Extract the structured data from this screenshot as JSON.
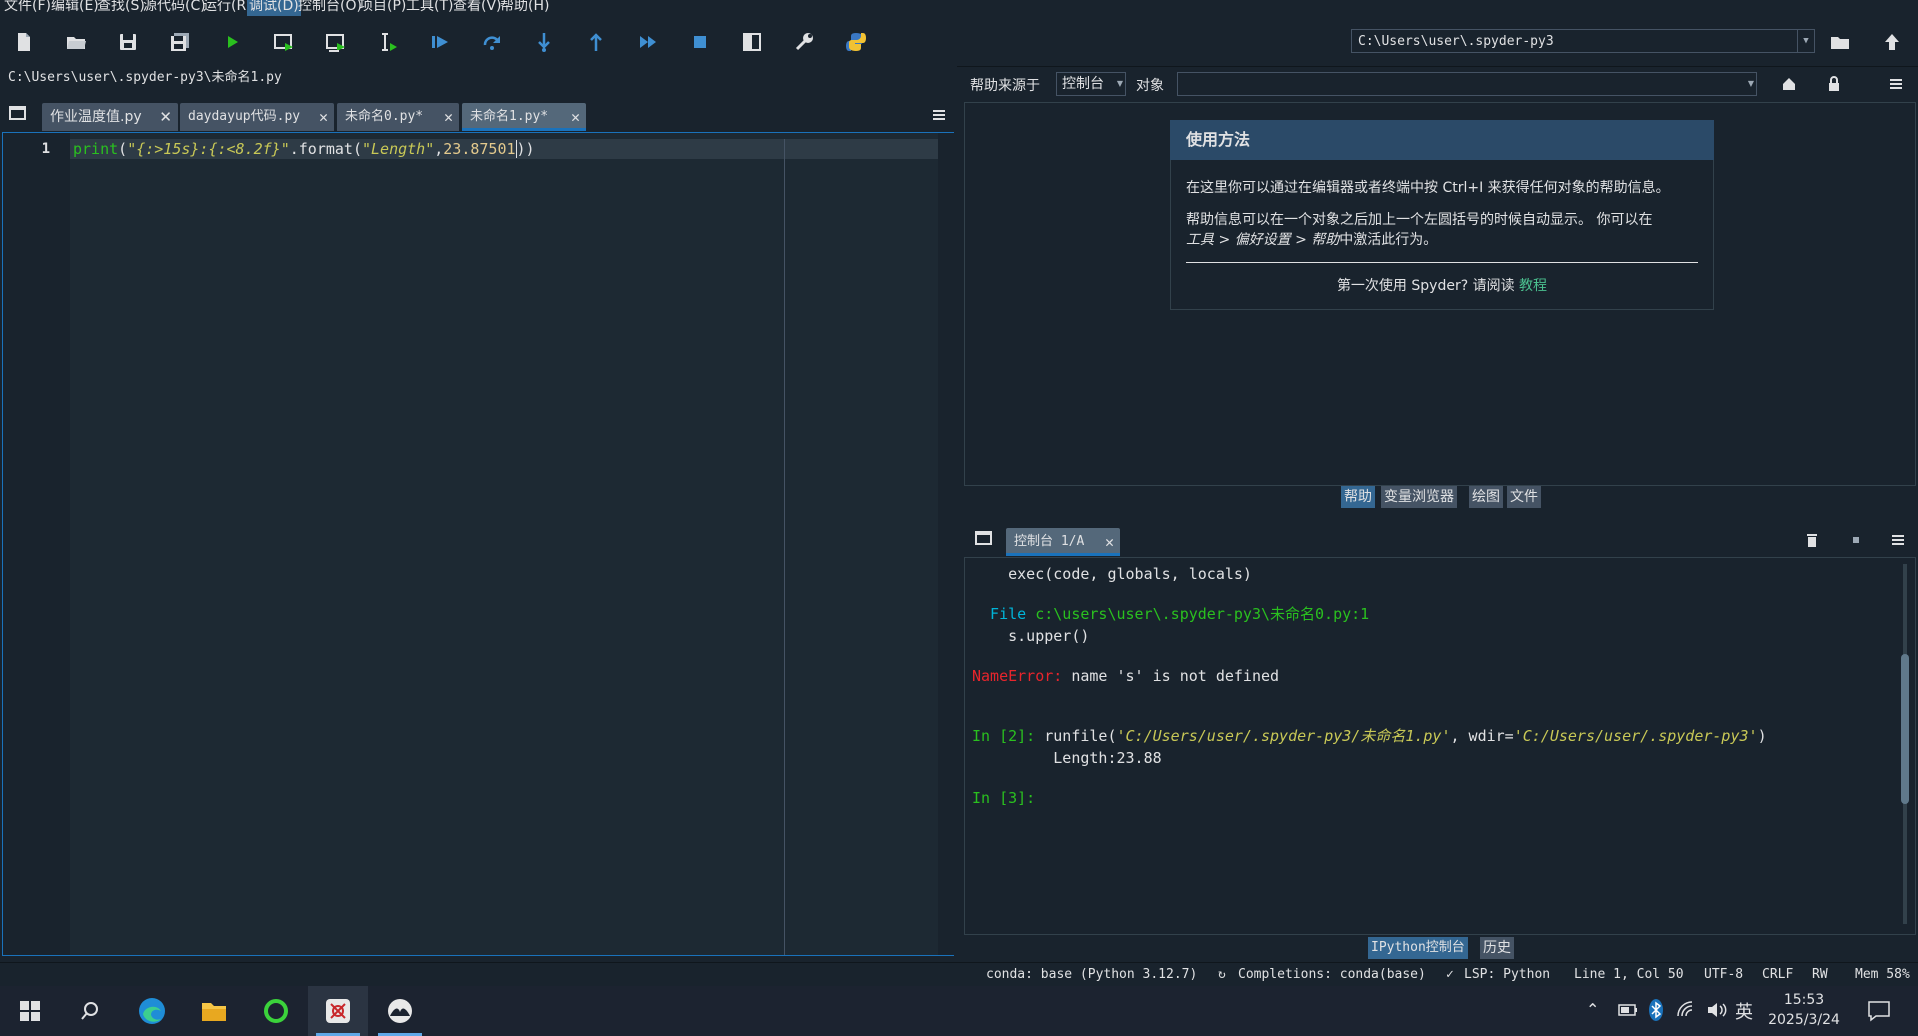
{
  "menubar": {
    "items": [
      "文件(F)",
      "编辑(E)",
      "查找(S)",
      "源代码(C)",
      "运行(R)",
      "调试(D)",
      "控制台(O)",
      "项目(P)",
      "工具(T)",
      "查看(V)",
      "帮助(H)"
    ],
    "active_index": 5
  },
  "toolbar": {
    "icons": [
      "new-file-icon",
      "open-file-icon",
      "save-icon",
      "save-all-icon",
      "run-icon",
      "run-cell-icon",
      "run-cell-advance-icon",
      "run-selection-icon",
      "debug-icon",
      "step-over-icon",
      "step-into-icon",
      "step-return-icon",
      "continue-icon",
      "stop-icon",
      "maximize-pane-icon",
      "preferences-icon",
      "python-path-icon"
    ],
    "working_dir": "C:\\Users\\user\\.spyder-py3"
  },
  "editor": {
    "path": "C:\\Users\\user\\.spyder-py3\\未命名1.py",
    "tabs": [
      {
        "label": "作业温度值.py",
        "active": false
      },
      {
        "label": "daydayup代码.py",
        "active": false
      },
      {
        "label": "未命名0.py*",
        "active": false
      },
      {
        "label": "未命名1.py*",
        "active": true
      }
    ],
    "line_number": "1",
    "code": {
      "fn": "print",
      "p1": "(",
      "str1": "\"{:>15s}:{:<8.2f}\"",
      "dot": ".format(",
      "str2": "\"Length\"",
      "comma": ",",
      "num": "23.87501",
      "close": "))"
    }
  },
  "help": {
    "source_label": "帮助来源于",
    "source_value": "控制台",
    "object_label": "对象",
    "object_value": "",
    "card_title": "使用方法",
    "text1": "在这里你可以通过在编辑器或者终端中按 Ctrl+I 来获得任何对象的帮助信息。",
    "text2a": "帮助信息可以在一个对象之后加上一个左圆括号的时候自动显示。 你可以在",
    "text2b_italic": "工具 > 偏好设置 > 帮助",
    "text2c": "中激活此行为。",
    "text3": "第一次使用 Spyder? 请阅读 ",
    "link": "教程"
  },
  "pane_tabs_top": [
    {
      "label": "帮助",
      "active": true
    },
    {
      "label": "变量浏览器",
      "active": false
    },
    {
      "label": "绘图",
      "active": false
    },
    {
      "label": "文件",
      "active": false
    }
  ],
  "console": {
    "tab_label": "控制台 1/A",
    "lines": {
      "l1": "    exec(code, globals, locals)",
      "l2_file": "  File ",
      "l2_path": "c:\\users\\user\\.spyder-py3\\未命名0.py:1",
      "l3": "    s.upper()",
      "l4_err": "NameError:",
      "l4_msg": " name 's' is not defined",
      "l5_prompt": "In [2]:",
      "l5_cmd": " runfile(",
      "l5_arg1": "'C:/Users/user/.spyder-py3/未命名1.py'",
      "l5_mid": ", wdir=",
      "l5_arg2": "'C:/Users/user/.spyder-py3'",
      "l5_end": ")",
      "l6": "         Length:23.88",
      "l7_prompt": "In [3]:"
    }
  },
  "pane_tabs_bottom": [
    {
      "label": "IPython控制台",
      "active": true
    },
    {
      "label": "历史",
      "active": false
    }
  ],
  "statusbar": {
    "conda": "conda: base (Python 3.12.7)",
    "completions": "Completions: conda(base)",
    "lsp": "LSP: Python",
    "position": "Line 1, Col 50",
    "encoding": "UTF-8",
    "eol": "CRLF",
    "rw": "RW",
    "mem": "Mem 58%"
  },
  "taskbar": {
    "time": "15:53",
    "date": "2025/3/24",
    "ime": "英"
  },
  "colors": {
    "accent": "#1a72bb",
    "keyword_green": "#2ac01f",
    "string_yellow": "#c8c856",
    "error_red": "#e8252c",
    "link_green": "#4bc08f"
  }
}
